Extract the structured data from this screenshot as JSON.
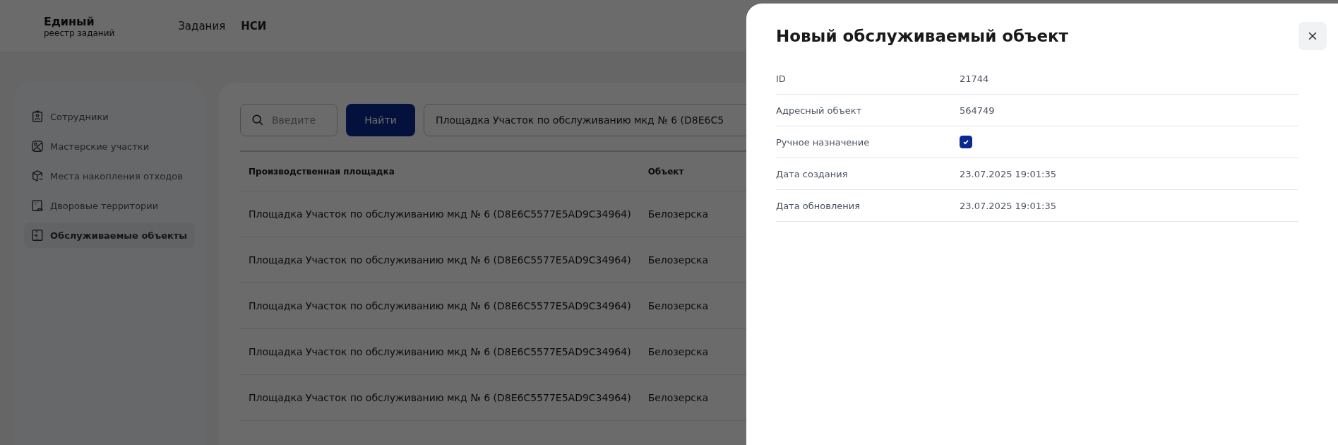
{
  "header": {
    "logo_title": "Единый",
    "logo_subtitle": "реестр заданий",
    "nav": [
      {
        "label": "Задания",
        "selected": false
      },
      {
        "label": "НСИ",
        "selected": true
      }
    ]
  },
  "sidebar": {
    "items": [
      {
        "label": "Сотрудники",
        "selected": false
      },
      {
        "label": "Мастерские участки",
        "selected": false
      },
      {
        "label": "Места накопления отходов",
        "selected": false
      },
      {
        "label": "Дворовые территории",
        "selected": false
      },
      {
        "label": "Обслуживаемые объекты",
        "selected": true
      }
    ]
  },
  "toolbar": {
    "search": {
      "placeholder": "Введите"
    },
    "find_button": "Найти",
    "filter_value": "Площадка Участок по обслуживанию мкд № 6 (D8E6C5"
  },
  "table": {
    "columns": [
      "Производственная площадка",
      "Объект"
    ],
    "rows": [
      [
        "Площадка Участок по обслуживанию мкд № 6 (D8E6C5577E5AD9C34964)",
        "Белозерска"
      ],
      [
        "Площадка Участок по обслуживанию мкд № 6 (D8E6C5577E5AD9C34964)",
        "Белозерска"
      ],
      [
        "Площадка Участок по обслуживанию мкд № 6 (D8E6C5577E5AD9C34964)",
        "Белозерска"
      ],
      [
        "Площадка Участок по обслуживанию мкд № 6 (D8E6C5577E5AD9C34964)",
        "Белозерска"
      ],
      [
        "Площадка Участок по обслуживанию мкд № 6 (D8E6C5577E5AD9C34964)",
        "Белозерска"
      ]
    ]
  },
  "drawer": {
    "title": "Новый обслуживаемый объект",
    "fields": [
      {
        "label": "ID",
        "kind": "text",
        "value": "21744"
      },
      {
        "label": "Адресный объект",
        "kind": "text",
        "value": "564749"
      },
      {
        "label": "Ручное назначение",
        "kind": "checkbox",
        "checked": true
      },
      {
        "label": "Дата создания",
        "kind": "text",
        "value": "23.07.2025 19:01:35"
      },
      {
        "label": "Дата обновления",
        "kind": "text",
        "value": "23.07.2025 19:01:35"
      }
    ]
  }
}
